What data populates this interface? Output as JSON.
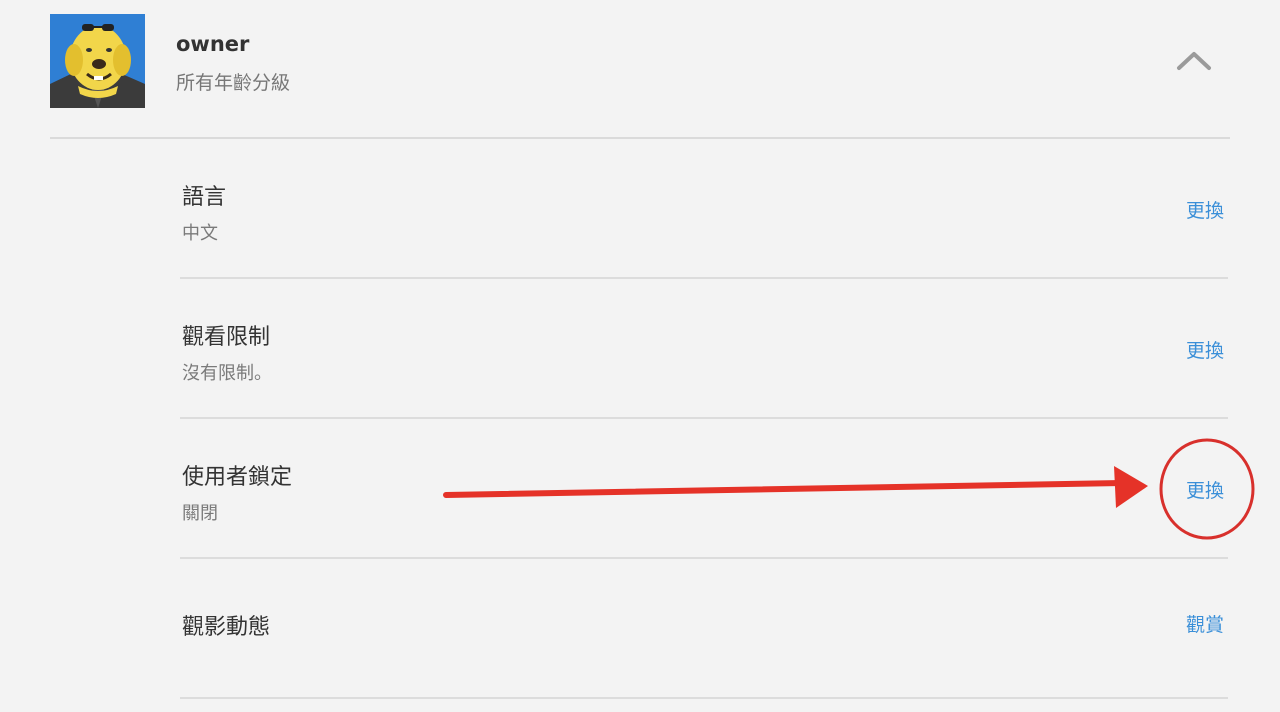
{
  "profile": {
    "name": "owner",
    "maturity": "所有年齡分級",
    "avatar_icon": "cartoon-dog-avatar"
  },
  "settings": [
    {
      "title": "語言",
      "value": "中文",
      "action": "更換"
    },
    {
      "title": "觀看限制",
      "value": "沒有限制。",
      "action": "更換"
    },
    {
      "title": "使用者鎖定",
      "value": "關閉",
      "action": "更換"
    },
    {
      "title": "觀影動態",
      "value": "",
      "action": "觀賞"
    }
  ],
  "colors": {
    "background": "#f3f3f3",
    "link": "#3a8fd8",
    "annotation": "#e53228"
  }
}
